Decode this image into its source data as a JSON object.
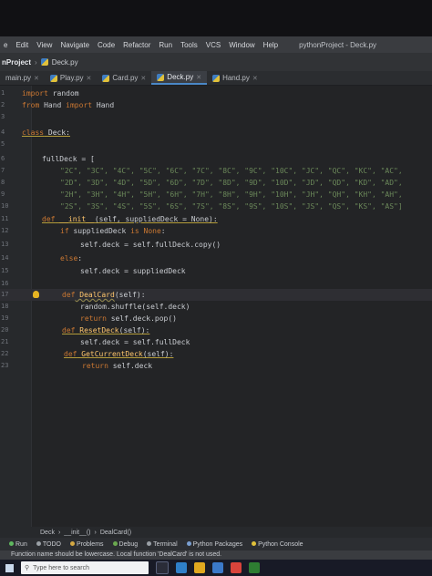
{
  "menu": [
    "e",
    "Edit",
    "View",
    "Navigate",
    "Code",
    "Refactor",
    "Run",
    "Tools",
    "VCS",
    "Window",
    "Help"
  ],
  "window_title": "pythonProject - Deck.py",
  "crumbs": {
    "project": "nProject",
    "file": "Deck.py"
  },
  "tabs": [
    {
      "label": "main.py",
      "active": false
    },
    {
      "label": "Play.py",
      "active": false
    },
    {
      "label": "Card.py",
      "active": false
    },
    {
      "label": "Deck.py",
      "active": true
    },
    {
      "label": "Hand.py",
      "active": false
    }
  ],
  "line_numbers": [
    "1",
    "2",
    "3",
    "4",
    "5",
    "6",
    "7",
    "8",
    "9",
    "10",
    "11",
    "12",
    "13",
    "14",
    "15",
    "16",
    "17",
    "18",
    "19",
    "20",
    "21",
    "22",
    "23"
  ],
  "code": {
    "l1_kw": "import",
    "l1_rest": " random",
    "l2_kw": "from",
    "l2_mid": " Hand ",
    "l2_kw2": "import",
    "l2_rest": " Hand",
    "l4_kw": "class",
    "l4_name": " Deck:",
    "l6": "fullDeck = [",
    "l7": "\"2C\", \"3C\", \"4C\", \"5C\", \"6C\", \"7C\", \"8C\", \"9C\", \"10C\", \"JC\", \"QC\", \"KC\", \"AC\",",
    "l8": "\"2D\", \"3D\", \"4D\", \"5D\", \"6D\", \"7D\", \"8D\", \"9D\", \"10D\", \"JD\", \"QD\", \"KD\", \"AD\",",
    "l9": "\"2H\", \"3H\", \"4H\", \"5H\", \"6H\", \"7H\", \"8H\", \"9H\", \"10H\", \"JH\", \"QH\", \"KH\", \"AH\",",
    "l10": "\"2S\", \"3S\", \"4S\", \"5S\", \"6S\", \"7S\", \"8S\", \"9S\", \"10S\", \"JS\", \"QS\", \"KS\", \"AS\"]",
    "l11_kw": "def",
    "l11_fn": " __init__",
    "l11_rest": "(self, suppliedDeck = None):",
    "l12_kw": "if",
    "l12_rest": " suppliedDeck ",
    "l12_kw2": "is None",
    "l12_end": ":",
    "l13": "self.deck = self.fullDeck.copy()",
    "l14_kw": "else",
    "l14_end": ":",
    "l15": "self.deck = suppliedDeck",
    "l17_kw": "def",
    "l17_fn": " DealCard",
    "l17_rest": "(self):",
    "l18": "random.shuffle(self.deck)",
    "l19_kw": "return",
    "l19_rest": " self.deck.pop()",
    "l20_kw": "def",
    "l20_fn": " ResetDeck",
    "l20_rest": "(self):",
    "l21": "self.deck = self.fullDeck",
    "l22_kw": "def",
    "l22_fn": " GetCurrentDeck",
    "l22_rest": "(self):",
    "l23_kw": "return",
    "l23_rest": " self.deck"
  },
  "bottom_breadcrumb": [
    "Deck",
    "__init__()",
    "DealCard()"
  ],
  "tool_windows": [
    "Run",
    "TODO",
    "Problems",
    "Debug",
    "Terminal",
    "Python Packages",
    "Python Console"
  ],
  "status_message": "Function name should be lowercase. Local function 'DealCard' is not used.",
  "taskbar": {
    "search_placeholder": "Type here to search"
  }
}
